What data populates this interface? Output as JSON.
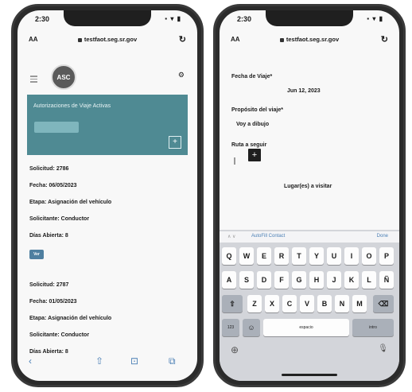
{
  "left_phone": {
    "status": {
      "time": "2:30",
      "icons": "▪ ▾ ▮"
    },
    "urlbar": {
      "aa": "AA",
      "url": "testfaot.seg.sr.gov",
      "reload": "↻"
    },
    "header": {
      "avatar": "ASC"
    },
    "banner": {
      "title": "Autorizaciones de Viaje Activas",
      "add": "+"
    },
    "requests": [
      {
        "solicitud": "Solicitud: 2786",
        "fecha": "Fecha: 06/05/2023",
        "etapa": "Etapa: Asignación del vehículo",
        "solicitante": "Solicitante: Conductor",
        "dias": "Días Abierta: 8",
        "button": "Ver"
      },
      {
        "solicitud": "Solicitud: 2787",
        "fecha": "Fecha: 01/05/2023",
        "etapa": "Etapa: Asignación del vehículo",
        "solicitante": "Solicitante: Conductor",
        "dias": "Días Abierta: 8"
      }
    ],
    "bottom_bar": {
      "back": "‹",
      "share": "⇧",
      "bookmarks": "⊡",
      "tabs": "⧉"
    }
  },
  "right_phone": {
    "status": {
      "time": "2:30",
      "icons": "▪ ▾ ▮"
    },
    "urlbar": {
      "aa": "AA",
      "url": "testfaot.seg.sr.gov",
      "reload": "↻"
    },
    "form": {
      "fecha_label": "Fecha de Viaje*",
      "fecha_value": "Jun 12, 2023",
      "proposito_label": "Propósito del viaje*",
      "proposito_value": "Voy a dibujo",
      "ruta_label": "Ruta a seguir",
      "lugares_label": "Lugar(es) a visitar",
      "add": "+"
    },
    "keyboard": {
      "toolbar": {
        "arrows": "∧ ∨",
        "autofill": "AutoFill Contact",
        "done": "Done"
      },
      "row1": [
        "Q",
        "W",
        "E",
        "R",
        "T",
        "Y",
        "U",
        "I",
        "O",
        "P"
      ],
      "row2": [
        "A",
        "S",
        "D",
        "F",
        "G",
        "H",
        "J",
        "K",
        "L",
        "Ñ"
      ],
      "row3": [
        "Z",
        "X",
        "C",
        "V",
        "B",
        "N",
        "M"
      ],
      "shift": "⇧",
      "backspace": "⌫",
      "numbers": "123",
      "emoji": "☺",
      "space": "espacio",
      "return": "intro",
      "globe": "⊕",
      "mic": "🎙"
    }
  }
}
